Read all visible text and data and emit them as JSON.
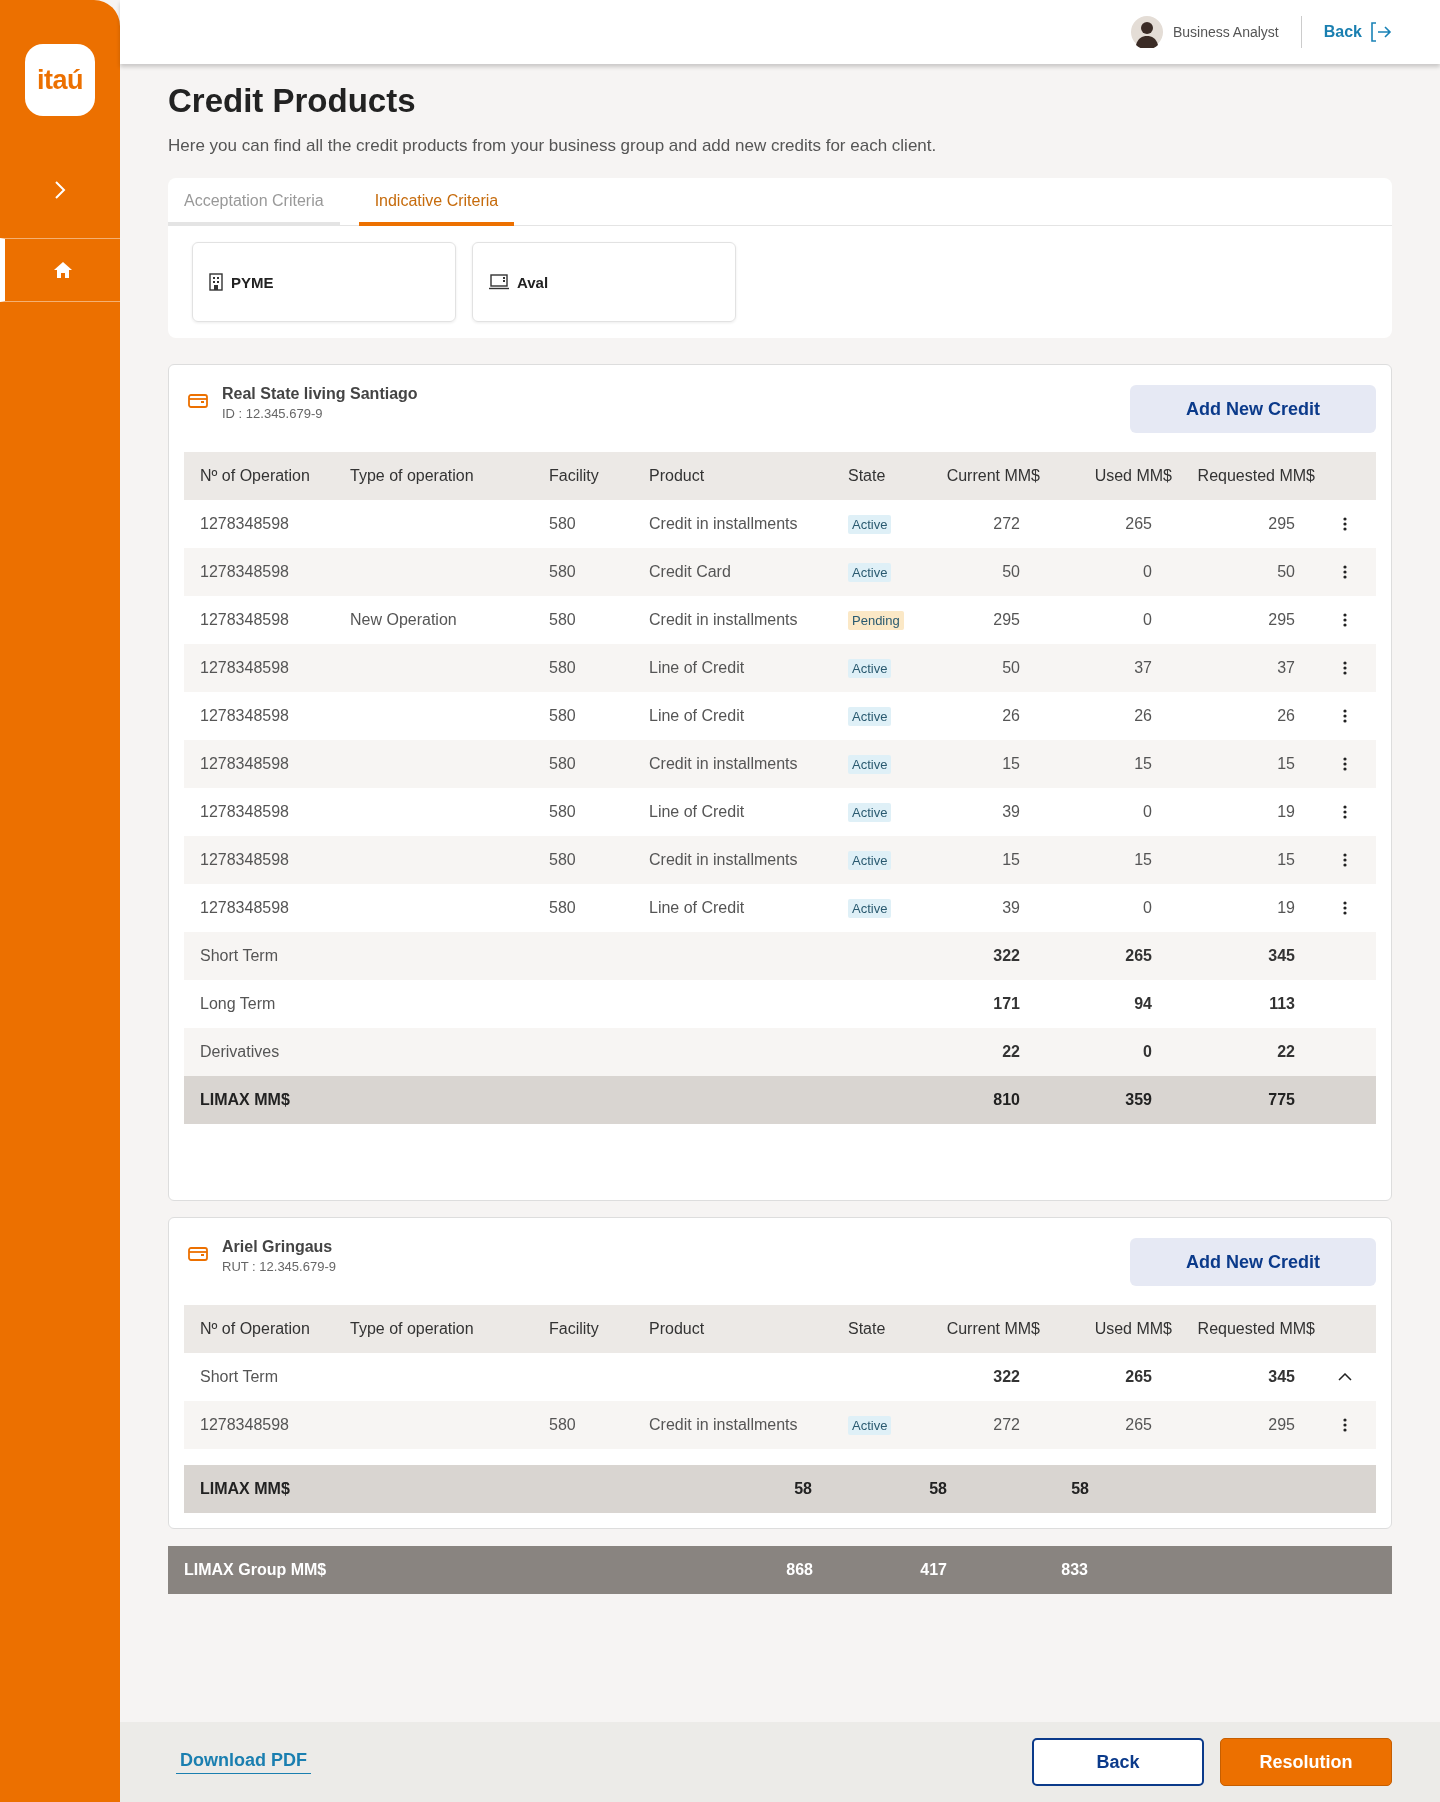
{
  "sidebar": {
    "logo": "itaú"
  },
  "header": {
    "user_name": "Business Analyst",
    "back_link": "Back"
  },
  "page": {
    "title": "Credit Products",
    "subtitle": "Here you can find all the credit products from your business group and add new credits for each client."
  },
  "tabs": [
    {
      "label": "Acceptation Criteria",
      "selected": false
    },
    {
      "label": "Indicative Criteria",
      "selected": true
    }
  ],
  "product_cards": [
    {
      "label": "PYME"
    },
    {
      "label": "Aval"
    }
  ],
  "sections": [
    {
      "name": "Real State living Santiago",
      "id_label": "ID : 12.345.679-9",
      "button": "Add New Credit",
      "columns": [
        "Nº of Operation",
        "Type of operation",
        "Facility",
        "Product",
        "State",
        "Current MM$",
        "Used MM$",
        "Requested MM$"
      ],
      "rows": [
        {
          "kind": "operation",
          "operation": "1278348598",
          "facility": "580",
          "product": "Credit in installments",
          "state": {
            "label": "Active",
            "color": "#dff0f7"
          },
          "current": "272",
          "used": "265",
          "requested": "295"
        },
        {
          "kind": "operation",
          "operation": "1278348598",
          "facility": "580",
          "product": "Credit Card",
          "state": {
            "label": "Active",
            "color": "#dff0f7"
          },
          "current": "50",
          "used": "0",
          "requested": "50"
        },
        {
          "kind": "operation",
          "operation": "1278348598",
          "type": "New Operation",
          "facility": "580",
          "product": "Credit in installments",
          "state": {
            "label": "Pending",
            "color": "#fbe8c6"
          },
          "current": "295",
          "used": "0",
          "requested": "295"
        },
        {
          "kind": "operation",
          "operation": "1278348598",
          "facility": "580",
          "product": "Line of Credit",
          "state": {
            "label": "Active",
            "color": "#dff0f7"
          },
          "current": "50",
          "used": "37",
          "requested": "37"
        },
        {
          "kind": "operation",
          "operation": "1278348598",
          "facility": "580",
          "product": "Line of Credit",
          "state": {
            "label": "Active",
            "color": "#dff0f7"
          },
          "current": "26",
          "used": "26",
          "requested": "26"
        },
        {
          "kind": "operation",
          "operation": "1278348598",
          "facility": "580",
          "product": "Credit in installments",
          "state": {
            "label": "Active",
            "color": "#dff0f7"
          },
          "current": "15",
          "used": "15",
          "requested": "15"
        },
        {
          "kind": "operation",
          "operation": "1278348598",
          "facility": "580",
          "product": "Line of Credit",
          "state": {
            "label": "Active",
            "color": "#dff0f7"
          },
          "current": "39",
          "used": "0",
          "requested": "19"
        },
        {
          "kind": "operation",
          "operation": "1278348598",
          "facility": "580",
          "product": "Credit in installments",
          "state": {
            "label": "Active",
            "color": "#dff0f7"
          },
          "current": "15",
          "used": "15",
          "requested": "15"
        },
        {
          "kind": "operation",
          "operation": "1278348598",
          "facility": "580",
          "product": "Line of Credit",
          "state": {
            "label": "Active",
            "color": "#dff0f7"
          },
          "current": "39",
          "used": "0",
          "requested": "19"
        },
        {
          "kind": "subtotal",
          "label": "Short Term",
          "current": "322",
          "used": "265",
          "requested": "345"
        },
        {
          "kind": "subtotal",
          "label": "Long Term",
          "current": "171",
          "used": "94",
          "requested": "113"
        },
        {
          "kind": "subtotal",
          "label": "Derivatives",
          "current": "22",
          "used": "0",
          "requested": "22"
        },
        {
          "kind": "total",
          "label": "LIMAX MM$",
          "current": "810",
          "used": "359",
          "requested": "775"
        }
      ]
    },
    {
      "name": "Ariel Gringaus",
      "id_label": "RUT : 12.345.679-9",
      "button": "Add New Credit",
      "columns": [
        "Nº of Operation",
        "Type of operation",
        "Facility",
        "Product",
        "State",
        "Current MM$",
        "Used MM$",
        "Requested MM$"
      ],
      "rows": [
        {
          "kind": "subtotal",
          "label": "Short Term",
          "current": "322",
          "used": "265",
          "requested": "345",
          "expanded": true
        },
        {
          "kind": "operation",
          "operation": "1278348598",
          "facility": "580",
          "product": "Credit in installments",
          "state": {
            "label": "Active",
            "color": "#dff0f7"
          },
          "current": "272",
          "used": "265",
          "requested": "295"
        },
        {
          "kind": "total_offset",
          "label": "LIMAX MM$",
          "current": "58",
          "used": "58",
          "requested": "58"
        }
      ]
    }
  ],
  "group_total": {
    "label": "LIMAX Group MM$",
    "current": "868",
    "used": "417",
    "requested": "833"
  },
  "footer": {
    "download": "Download PDF",
    "buttons": [
      {
        "label": "Back",
        "kind": "secondary"
      },
      {
        "label": "Resolution",
        "kind": "primary"
      }
    ]
  }
}
